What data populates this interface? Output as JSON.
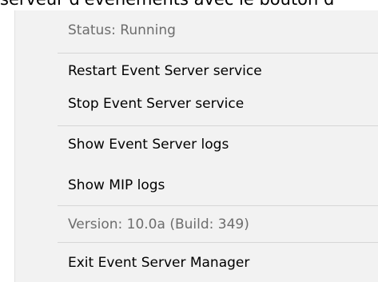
{
  "backdrop": {
    "text": "serveur d'événements avec le bouton d"
  },
  "colors": {
    "menu_background": "#f2f2f2",
    "separator": "#d6d6d6",
    "enabled_text": "#000000",
    "disabled_text": "#6d6d6d"
  },
  "menu": {
    "status": "Status: Running",
    "restart": "Restart Event Server service",
    "stop": "Stop Event Server service",
    "show_event_logs": "Show Event Server logs",
    "show_mip_logs": "Show MIP logs",
    "version": "Version: 10.0a (Build: 349)",
    "exit": "Exit Event Server Manager"
  }
}
